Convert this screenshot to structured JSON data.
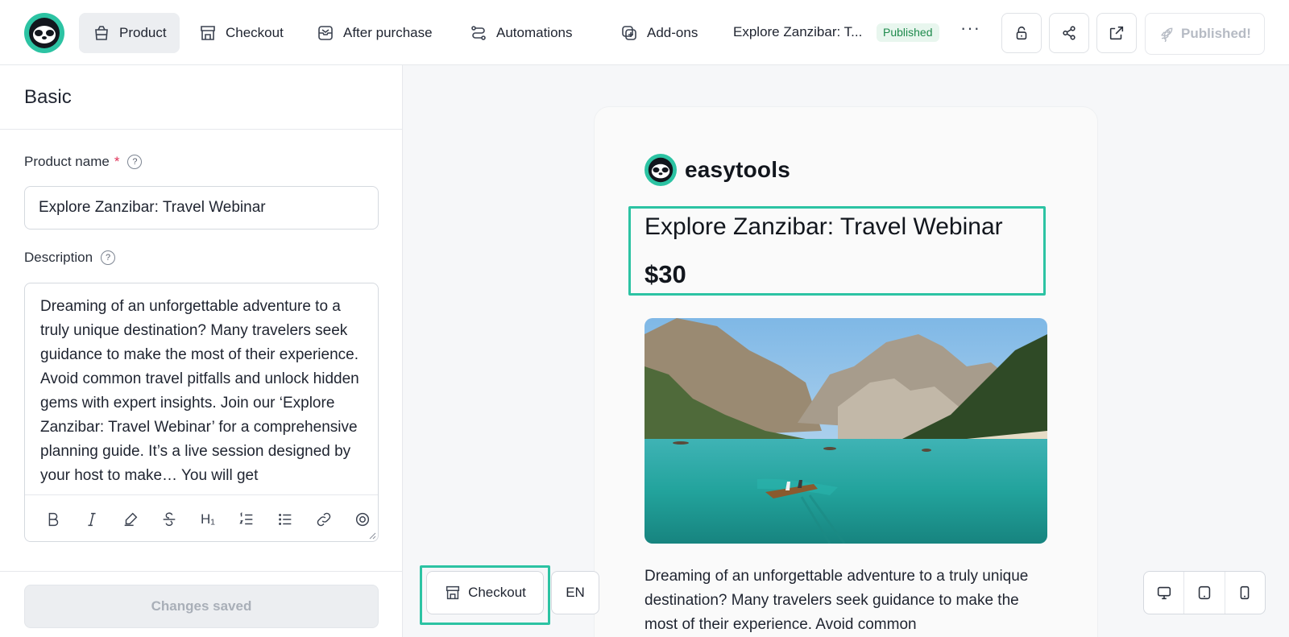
{
  "nav": {
    "items": [
      {
        "label": "Product",
        "icon": "box-icon",
        "active": true
      },
      {
        "label": "Checkout",
        "icon": "storefront-icon",
        "active": false
      },
      {
        "label": "After purchase",
        "icon": "mail-inbox-icon",
        "active": false
      },
      {
        "label": "Automations",
        "icon": "route-icon",
        "active": false
      },
      {
        "label": "Add-ons",
        "icon": "plus-square-icon",
        "active": false
      }
    ],
    "doc_title": "Explore Zanzibar: T...",
    "status_badge": "Published",
    "more_label": "···",
    "published_button": "Published!"
  },
  "left_panel": {
    "section_title": "Basic",
    "product_name_label": "Product name",
    "required_mark": "*",
    "product_name_value": "Explore Zanzibar: Travel Webinar",
    "description_label": "Description",
    "description_value": "Dreaming of an unforgettable adventure to a truly unique destination? Many travelers seek guidance to make the most of their experience. Avoid common travel pitfalls and unlock hidden gems with expert insights. Join our ‘Explore Zanzibar: Travel Webinar’ for a comprehensive planning guide. It’s a live session designed by your host to make… You will get",
    "toolbar_heading_label": "H₁",
    "save_status": "Changes saved"
  },
  "preview": {
    "brand_name": "easytools",
    "product_title": "Explore Zanzibar: Travel Webinar",
    "price": "$30",
    "description": "Dreaming of an unforgettable adventure to a truly unique destination? Many travelers seek guidance to make the most of their experience. Avoid common",
    "checkout_button": "Checkout",
    "language_button": "EN"
  },
  "colors": {
    "accent": "#2cc3a3",
    "published_badge_bg": "#e8f6ee",
    "published_badge_text": "#1e8a4c",
    "required": "#e0345a"
  }
}
